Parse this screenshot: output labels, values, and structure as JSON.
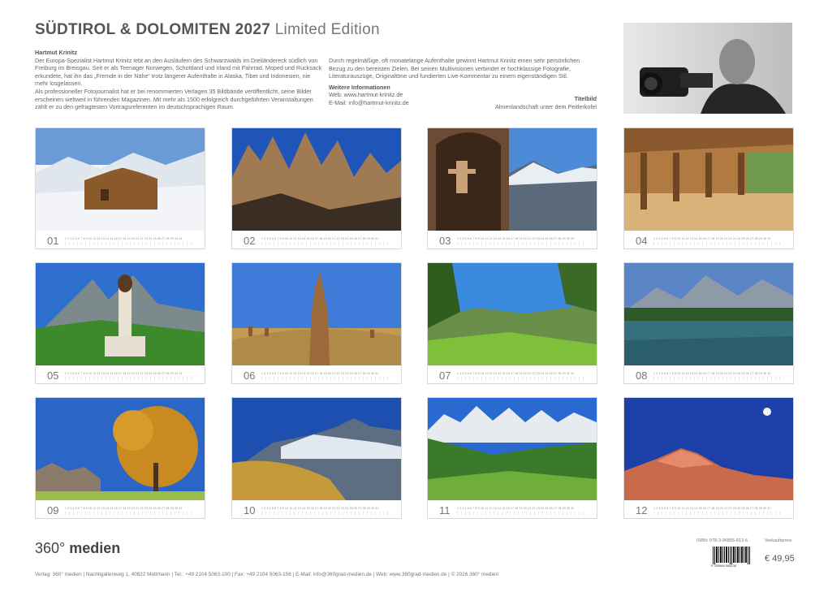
{
  "header": {
    "title_main": "SÜDTIROL & DOLOMITEN 2027",
    "title_edition": "Limited Edition"
  },
  "author": {
    "heading": "Hartmut Krinitz",
    "bio_1": "Der Europa-Spezialist Hartmut Krinitz lebt an den Ausläufern des Schwarzwalds im Dreiländereck südlich von Freiburg im Breisgau. Seit er als Teenager Norwegen, Schottland und Irland mit Fahrrad, Moped und Rucksack erkundete, hat ihn das „Fremde in der Nähe“ trotz längerer Aufenthalte in Alaska, Tibet und Indonesien, nie mehr losgelassen.",
    "bio_2": "Als professioneller Fotojournalist hat er bei renommierten Verlagen 35 Bildbände veröffentlicht, seine Bilder erscheinen weltweit in führenden Magazinen. Mit mehr als 1500 erfolgreich durchgeführten Veranstaltungen zählt er zu den gefragtesten Vortragsreferenten im deutschsprachigen Raum.",
    "bio_3": "Durch regelmäßige, oft monatelange Aufenthalte gewinnt Hartmut Krinitz einen sehr persönlichen Bezug zu den bereisten Zielen. Bei seinen Multivisionen verbindet er hochklassige Fotografie, Literaturauszüge, Originaltöne und fundierten Live-Kommentar zu einem eigenständigen Stil.",
    "more_heading": "Weitere Informationen",
    "web": "Web: www.hartmut-krinitz.de",
    "email": "E-Mail: info@hartmut-krinitz.de"
  },
  "cover": {
    "heading": "Titelbild",
    "caption": "Almenlandschaft unter dem Peitlerkofel"
  },
  "months": [
    {
      "num": "01"
    },
    {
      "num": "02"
    },
    {
      "num": "03"
    },
    {
      "num": "04"
    },
    {
      "num": "05"
    },
    {
      "num": "06"
    },
    {
      "num": "07"
    },
    {
      "num": "08"
    },
    {
      "num": "09"
    },
    {
      "num": "10"
    },
    {
      "num": "11"
    },
    {
      "num": "12"
    }
  ],
  "days_row": "1 2 3 4 5 6 7 8 9 10 11 12 13 14 15 16 17 18 19 20 21 22 23 24 25 26 27 28 29 30 31",
  "publisher": {
    "logo_num": "360°",
    "logo_word": "medien",
    "isbn": "ISBN: 978-3-96855-813-6",
    "price_label": "Verkaufspreis",
    "price": "€ 49,95",
    "barcode_text": "9 783968 558134",
    "footer": "Verlag: 360° medien  |  Nachtigallenweg 1, 40822 Mettmann  |  Tel.: +49 2104 5063-100  |  Fax: +49 2104 5063-156  |  E-Mail: info@360grad-medien.de  |  Web: www.360grad-medien.de  |  © 2026 360° medien"
  },
  "colors": {
    "accent_text": "#555555",
    "border": "#d8d8d8"
  }
}
